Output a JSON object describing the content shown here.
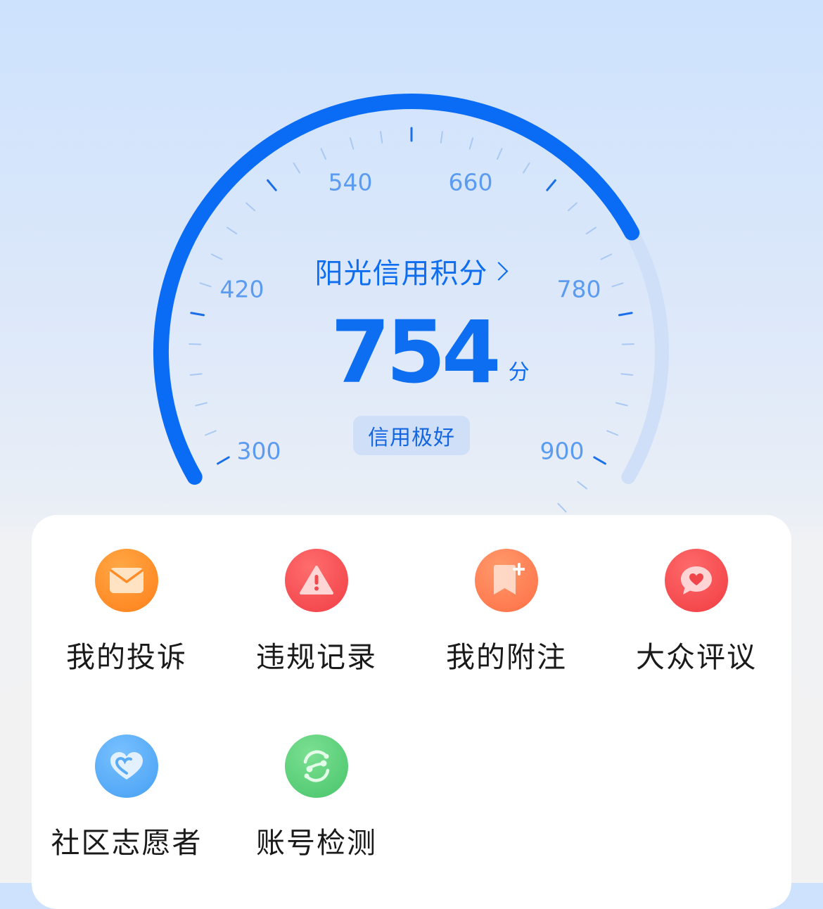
{
  "gauge": {
    "title": "阳光信用积分",
    "score": "754",
    "unit": "分",
    "level": "信用极好",
    "score_value": 754,
    "scale_min": 300,
    "scale_max": 900,
    "tick_labels": [
      "300",
      "420",
      "540",
      "660",
      "780",
      "900"
    ],
    "colors": {
      "active_arc": "#0a6cf5",
      "track_arc": "#cfdff8",
      "tick": "#a9c8f2",
      "tick_major": "#1a6fe8",
      "label": "#5b9bf0"
    }
  },
  "menu": {
    "items": [
      {
        "label": "我的投诉",
        "icon": "mail-icon",
        "color": "#ff8b24"
      },
      {
        "label": "违规记录",
        "icon": "warning-icon",
        "color": "#f74e52"
      },
      {
        "label": "我的附注",
        "icon": "bookmark-add-icon",
        "color": "#ff7e55"
      },
      {
        "label": "大众评议",
        "icon": "chat-heart-icon",
        "color": "#f64a4f"
      },
      {
        "label": "社区志愿者",
        "icon": "heart-icon",
        "color": "#5aabf5"
      },
      {
        "label": "账号检测",
        "icon": "scan-icon",
        "color": "#5fd27a"
      }
    ]
  }
}
